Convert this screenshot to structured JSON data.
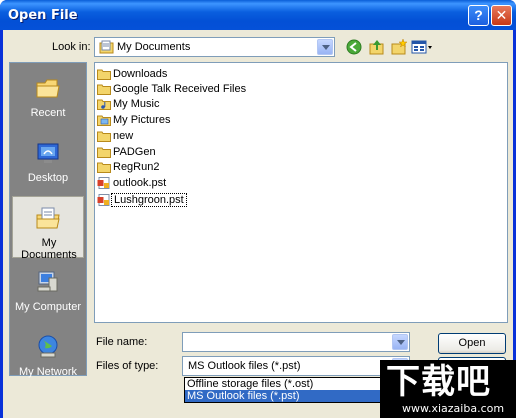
{
  "window": {
    "title": "Open File"
  },
  "lookin": {
    "label": "Look in:",
    "value": "My Documents"
  },
  "toolbar": {
    "back": "back-icon",
    "up": "up-folder-icon",
    "new_folder": "new-folder-icon",
    "views": "views-menu-icon"
  },
  "places": [
    {
      "label": "Recent",
      "icon": "recent-icon"
    },
    {
      "label": "Desktop",
      "icon": "desktop-icon"
    },
    {
      "label": "My Documents",
      "icon": "my-documents-icon"
    },
    {
      "label": "My Computer",
      "icon": "my-computer-icon"
    },
    {
      "label": "My Network",
      "icon": "my-network-icon"
    }
  ],
  "files": [
    {
      "name": "Downloads",
      "type": "folder"
    },
    {
      "name": "Google Talk Received Files",
      "type": "folder"
    },
    {
      "name": "My Music",
      "type": "music-folder"
    },
    {
      "name": "My Pictures",
      "type": "pictures-folder"
    },
    {
      "name": "new",
      "type": "folder"
    },
    {
      "name": "PADGen",
      "type": "folder"
    },
    {
      "name": "RegRun2",
      "type": "folder"
    },
    {
      "name": "outlook.pst",
      "type": "pst-file"
    },
    {
      "name": "Lushgroon.pst",
      "type": "pst-file"
    }
  ],
  "filename": {
    "label": "File name:",
    "value": ""
  },
  "filetype": {
    "label": "Files of type:",
    "value": "MS Outlook files (*.pst)",
    "options": [
      "Offline storage files (*.ost)",
      "MS Outlook files (*.pst)"
    ]
  },
  "buttons": {
    "open": "Open"
  },
  "watermark": {
    "main": "下载吧",
    "sub": "www.xiazaiba.com"
  },
  "colors": {
    "titlebar": "#0a5fdf",
    "selection": "#316ac5",
    "face": "#ece9d8"
  }
}
